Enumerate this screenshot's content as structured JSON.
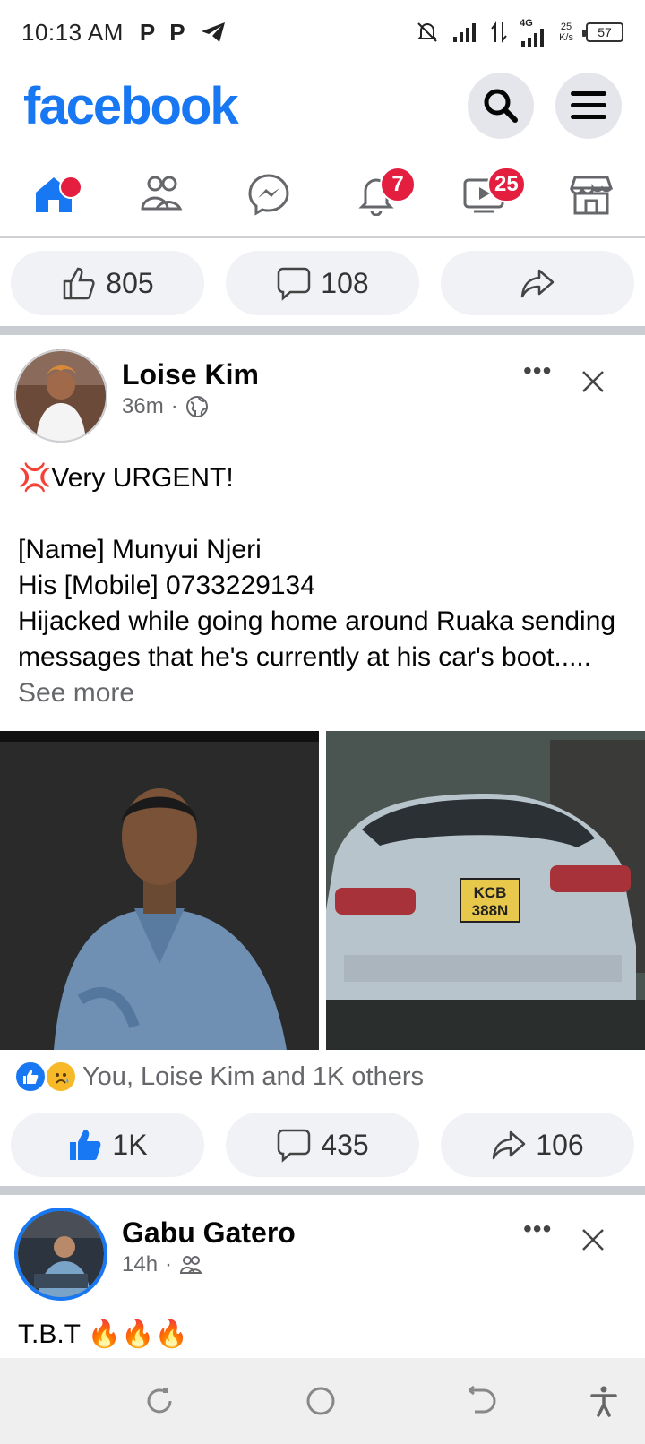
{
  "status_bar": {
    "time": "10:13 AM",
    "left_icons": [
      "P",
      "P"
    ],
    "network": "4G",
    "speed_top": "25",
    "speed_bottom": "K/s",
    "battery": "57"
  },
  "header": {
    "logo": "facebook"
  },
  "nav": {
    "notifications_badge": "7",
    "watch_badge": "25"
  },
  "prev_post_actions": {
    "like_count": "805",
    "comment_count": "108"
  },
  "post1": {
    "author": "Loise Kim",
    "time": "36m",
    "more_label": "•••",
    "line1": "💢Very URGENT!",
    "line2": "[Name] Munyui Njeri",
    "line3": "His [Mobile] 0733229134",
    "line4": "Hijacked while going home around Ruaka sending messages that he's currently at his car's boot.....",
    "see_more": "See more",
    "plate_line1": "KCB",
    "plate_line2": "388N",
    "reactions_text": "You, Loise Kim and 1K others",
    "like_count": "1K",
    "comment_count": "435",
    "share_count": "106"
  },
  "post2": {
    "author": "Gabu Gatero",
    "time": "14h",
    "more_label": "•••",
    "text": "T.B.T 🔥🔥🔥"
  }
}
